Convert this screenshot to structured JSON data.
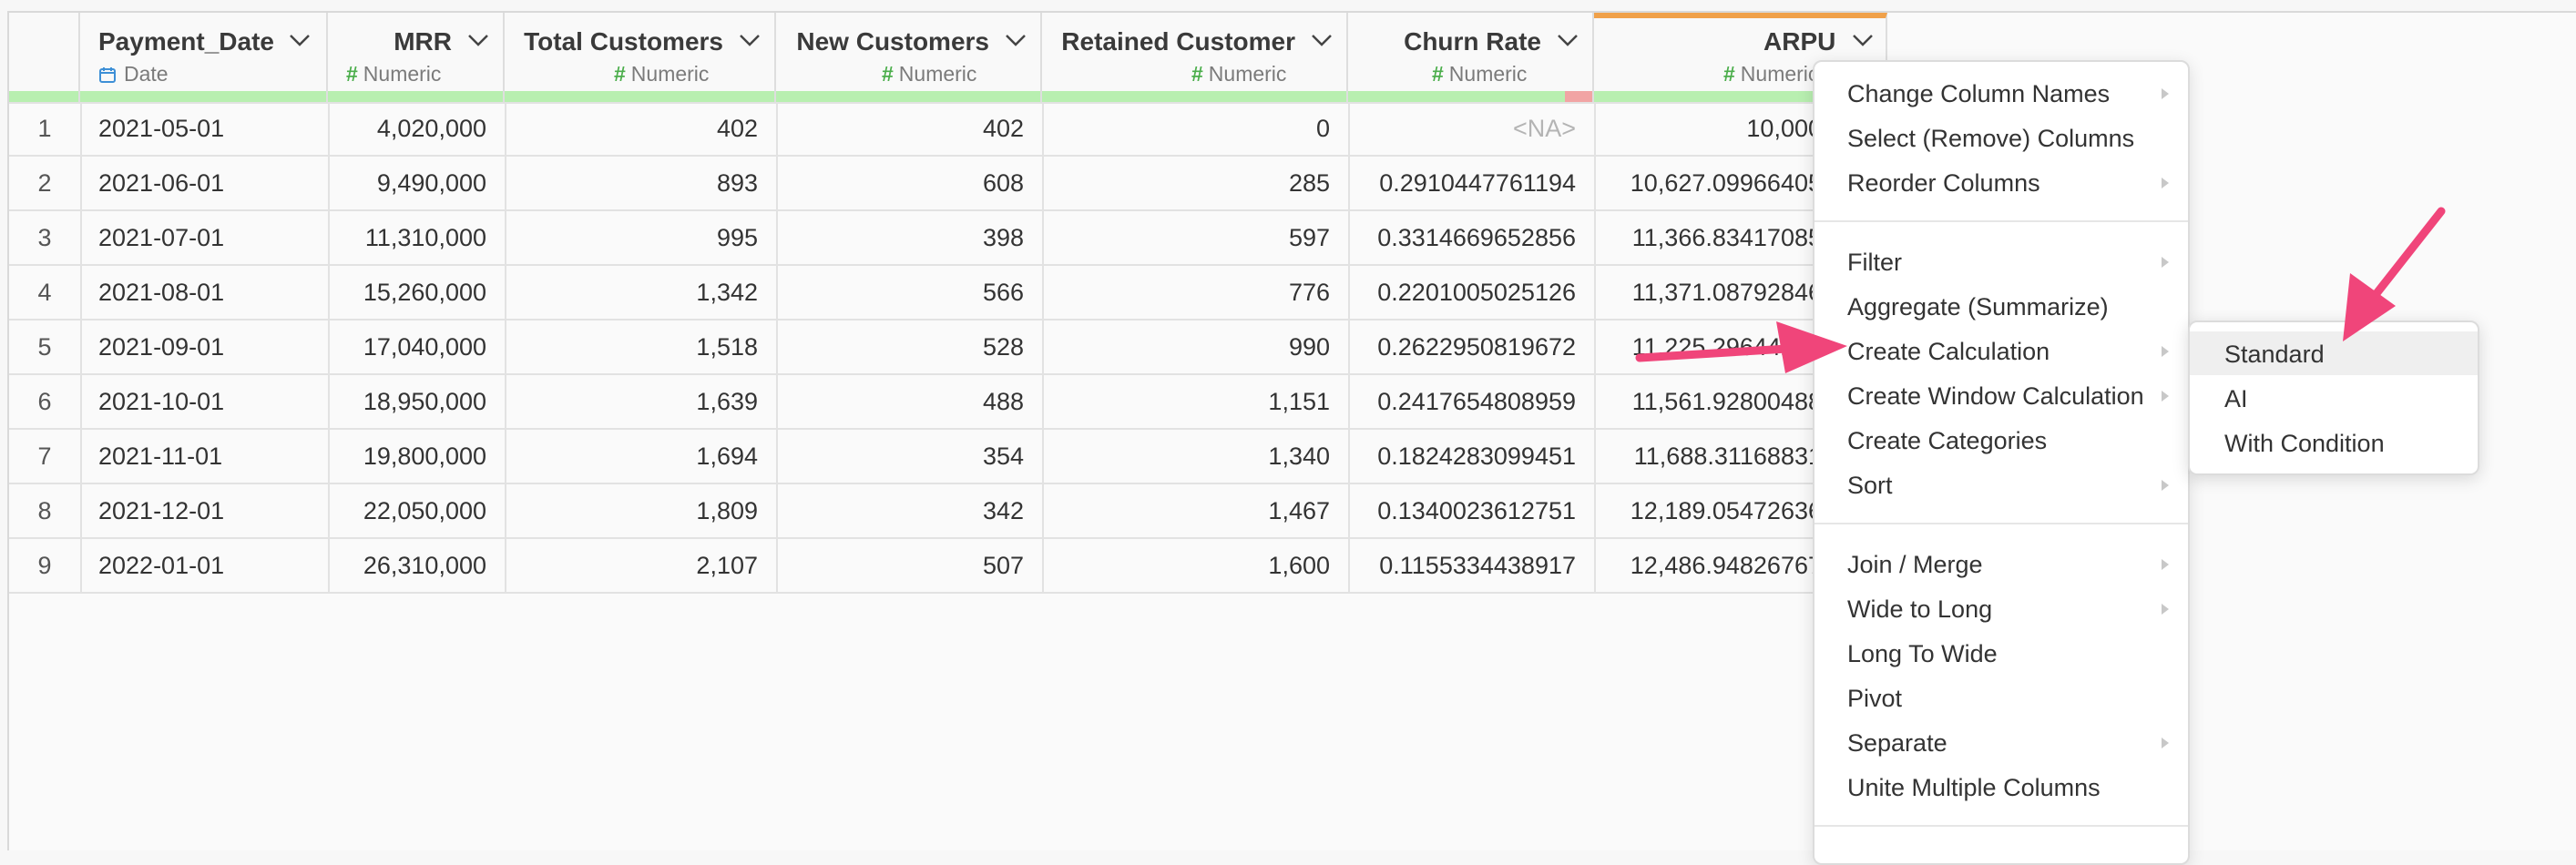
{
  "columns": [
    {
      "name": "Payment_Date",
      "type": "Date"
    },
    {
      "name": "MRR",
      "type": "Numeric"
    },
    {
      "name": "Total Customers",
      "type": "Numeric"
    },
    {
      "name": "New Customers",
      "type": "Numeric"
    },
    {
      "name": "Retained Customer",
      "type": "Numeric"
    },
    {
      "name": "Churn Rate",
      "type": "Numeric"
    },
    {
      "name": "ARPU",
      "type": "Numeric"
    }
  ],
  "rows": [
    {
      "idx": "1",
      "date": "2021-05-01",
      "mrr": "4,020,000",
      "total": "402",
      "new": "402",
      "retained": "0",
      "churn": "<NA>",
      "arpu": "10,000"
    },
    {
      "idx": "2",
      "date": "2021-06-01",
      "mrr": "9,490,000",
      "total": "893",
      "new": "608",
      "retained": "285",
      "churn": "0.2910447761194",
      "arpu": "10,627.09966405"
    },
    {
      "idx": "3",
      "date": "2021-07-01",
      "mrr": "11,310,000",
      "total": "995",
      "new": "398",
      "retained": "597",
      "churn": "0.3314669652856",
      "arpu": "11,366.83417085"
    },
    {
      "idx": "4",
      "date": "2021-08-01",
      "mrr": "15,260,000",
      "total": "1,342",
      "new": "566",
      "retained": "776",
      "churn": "0.2201005025126",
      "arpu": "11,371.08792846"
    },
    {
      "idx": "5",
      "date": "2021-09-01",
      "mrr": "17,040,000",
      "total": "1,518",
      "new": "528",
      "retained": "990",
      "churn": "0.2622950819672",
      "arpu": "11,225.29644269"
    },
    {
      "idx": "6",
      "date": "2021-10-01",
      "mrr": "18,950,000",
      "total": "1,639",
      "new": "488",
      "retained": "1,151",
      "churn": "0.2417654808959",
      "arpu": "11,561.92800488"
    },
    {
      "idx": "7",
      "date": "2021-11-01",
      "mrr": "19,800,000",
      "total": "1,694",
      "new": "354",
      "retained": "1,340",
      "churn": "0.1824283099451",
      "arpu": "11,688.31168831"
    },
    {
      "idx": "8",
      "date": "2021-12-01",
      "mrr": "22,050,000",
      "total": "1,809",
      "new": "342",
      "retained": "1,467",
      "churn": "0.1340023612751",
      "arpu": "12,189.05472636"
    },
    {
      "idx": "9",
      "date": "2022-01-01",
      "mrr": "26,310,000",
      "total": "2,107",
      "new": "507",
      "retained": "1,600",
      "churn": "0.1155334438917",
      "arpu": "12,486.94826767"
    }
  ],
  "menu": {
    "items": [
      "Change Column Names",
      "Select (Remove) Columns",
      "Reorder Columns",
      "Filter",
      "Aggregate (Summarize)",
      "Create Calculation",
      "Create Window Calculation",
      "Create Categories",
      "Sort",
      "Join / Merge",
      "Wide to Long",
      "Long To Wide",
      "Pivot",
      "Separate",
      "Unite Multiple Columns"
    ]
  },
  "submenu": {
    "items": [
      "Standard",
      "AI",
      "With Condition"
    ]
  },
  "colors": {
    "accent_arrow": "#f0457a",
    "type_hash": "#4cae4c",
    "quality_bar": "#b8efb0",
    "quality_bad": "#f1a4a4",
    "selected_column": "#f0a14a",
    "date_icon": "#3d8fd6"
  }
}
